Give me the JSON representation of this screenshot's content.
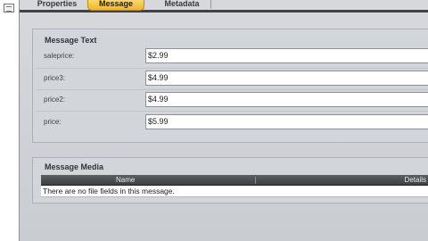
{
  "tabs": {
    "properties": "Properties",
    "message": "Message",
    "metadata": "Metadata"
  },
  "message_text": {
    "title": "Message Text",
    "fields": [
      {
        "label": "saleprice:",
        "value": "$2.99"
      },
      {
        "label": "price3:",
        "value": "$4.99"
      },
      {
        "label": "price2:",
        "value": "$4.99"
      },
      {
        "label": "price:",
        "value": "$5.99"
      }
    ]
  },
  "message_media": {
    "title": "Message Media",
    "columns": {
      "name": "Name",
      "details": "Details"
    },
    "empty_text": "There are no file fields in this message."
  },
  "colors": {
    "active_tab": "#f0b62b",
    "header_bar": "#404246",
    "background": "#cdd0d4"
  }
}
